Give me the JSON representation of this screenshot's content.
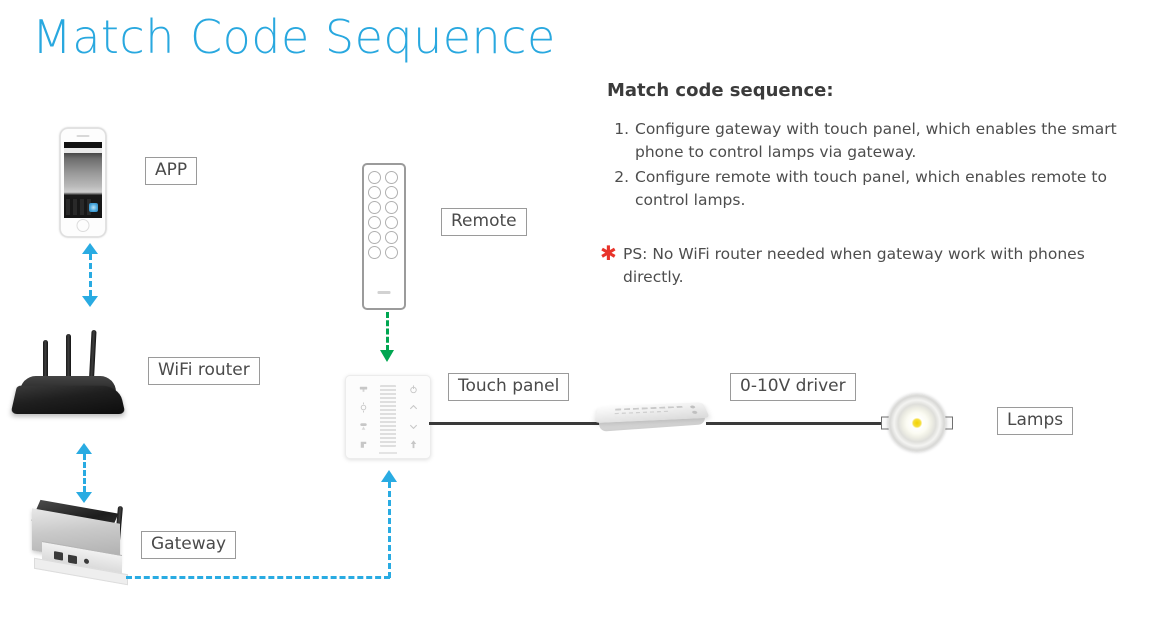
{
  "title": "Match Code Sequence",
  "colors": {
    "title": "#29A8DF",
    "cyan_arrow": "#29ABE2",
    "green_arrow": "#00A651",
    "wire": "#3a3a3a",
    "star": "#E8332A",
    "label_border": "#9a9a9a",
    "body_text": "#4d4d4d"
  },
  "labels": {
    "app": "APP",
    "wifi_router": "WiFi router",
    "gateway": "Gateway",
    "remote": "Remote",
    "touch_panel": "Touch panel",
    "driver": "0-10V driver",
    "lamps": "Lamps"
  },
  "instructions": {
    "heading": "Match code sequence:",
    "steps": [
      {
        "number": "1.",
        "text": "Configure gateway with touch panel, which enables the smart phone to control lamps via gateway."
      },
      {
        "number": "2.",
        "text": "Configure remote with touch panel, which enables remote to control lamps."
      }
    ],
    "note_marker": "✱",
    "note": "PS: No WiFi router needed when gateway work with phones directly."
  },
  "connections": [
    {
      "name": "app-to-router",
      "style": "dashed",
      "color": "#29ABE2",
      "direction": "bidirectional"
    },
    {
      "name": "router-to-gateway",
      "style": "dashed",
      "color": "#29ABE2",
      "direction": "bidirectional"
    },
    {
      "name": "gateway-to-touch-panel",
      "style": "dashed",
      "color": "#29ABE2",
      "direction": "up"
    },
    {
      "name": "remote-to-touch-panel",
      "style": "dashed",
      "color": "#00A651",
      "direction": "down"
    },
    {
      "name": "touch-panel-to-driver",
      "style": "solid",
      "color": "#3a3a3a",
      "direction": "none"
    },
    {
      "name": "driver-to-lamps",
      "style": "solid",
      "color": "#3a3a3a",
      "direction": "none"
    }
  ]
}
